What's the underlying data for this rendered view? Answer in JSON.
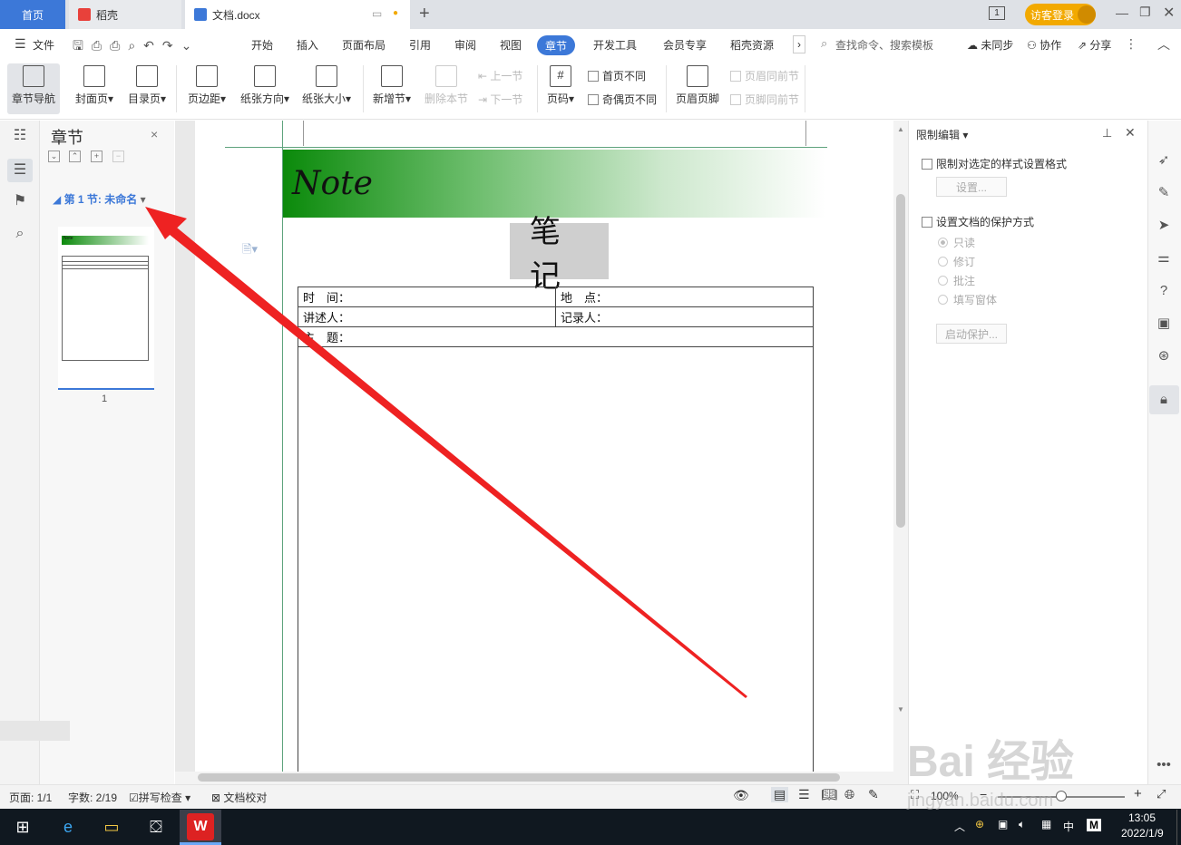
{
  "titlebar": {
    "home_tab": "首页",
    "daoke_tab": "稻壳",
    "doc_tab": "文档.docx",
    "new_tab": "+",
    "page_count_icon": "1",
    "login": "访客登录"
  },
  "menu": {
    "file": "文件",
    "items": [
      "开始",
      "插入",
      "页面布局",
      "引用",
      "审阅",
      "视图",
      "章节",
      "开发工具",
      "会员专享",
      "稻壳资源"
    ],
    "search_placeholder": "查找命令、搜索模板",
    "sync": "未同步",
    "collab": "协作",
    "share": "分享"
  },
  "ribbon": {
    "nav": "章节导航",
    "cover": "封面页",
    "toc": "目录页",
    "margin": "页边距",
    "orientation": "纸张方向",
    "size": "纸张大小",
    "new_section": "新增节",
    "delete_section": "删除本节",
    "prev_section": "上一节",
    "next_section": "下一节",
    "page_number": "页码",
    "first_page_diff": "首页不同",
    "odd_even_diff": "奇偶页不同",
    "header_footer": "页眉页脚",
    "header_same": "页眉同前节",
    "footer_same": "页脚同前节"
  },
  "chapter_panel": {
    "title": "章节",
    "close": "×",
    "item": "第 1 节: 未命名",
    "page_num": "1",
    "thumb_note": "Note"
  },
  "document": {
    "banner_title": "Note",
    "heading": "笔 记",
    "table": {
      "time": "时　间：",
      "place": "地　点：",
      "speaker": "讲述人：",
      "recorder": "记录人：",
      "topic": "主　题："
    }
  },
  "restrict_panel": {
    "title": "限制编辑",
    "limit_format": "限制对选定的样式设置格式",
    "settings_btn": "设置...",
    "protect_mode": "设置文档的保护方式",
    "options": [
      "只读",
      "修订",
      "批注",
      "填写窗体"
    ],
    "start_btn": "启动保护..."
  },
  "status": {
    "page": "页面: 1/1",
    "words": "字数: 2/19",
    "spell": "拼写检查",
    "proof": "文档校对",
    "zoom": "100%"
  },
  "taskbar": {
    "time": "13:05",
    "date": "2022/1/9",
    "ime": "中",
    "ime2": "M"
  },
  "watermark": {
    "logo": "Bai 经验",
    "url": "jingyan.baidu.com"
  },
  "colors": {
    "accent": "#3c78d8",
    "login": "#f2a900",
    "banner_green": "#0b8a0b",
    "arrow": "#ee2222"
  }
}
